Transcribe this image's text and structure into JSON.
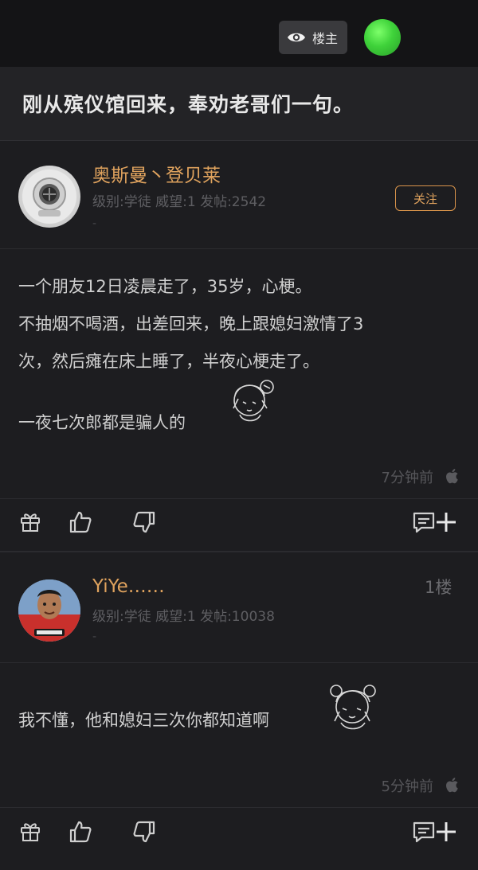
{
  "header": {
    "only_op_label": "楼主",
    "icons": [
      "eye-icon",
      "status-dot-icon"
    ]
  },
  "thread": {
    "title": "刚从殡仪馆回来，奉劝老哥们一句。"
  },
  "posts": [
    {
      "username": "奥斯曼丶登贝莱",
      "meta": "级别:学徒  威望:1  发帖:2542",
      "follow_label": "关注",
      "body": [
        "一个朋友12日凌晨走了，35岁，心梗。",
        "不抽烟不喝酒，出差回来，晚上跟媳妇激情了3",
        "次，然后瘫在床上睡了，半夜心梗走了。",
        "一夜七次郎都是骗人的"
      ],
      "time": "7分钟前",
      "device_icon": "apple-icon"
    },
    {
      "username": "YiYe……",
      "floor": "1楼",
      "meta": "级别:学徒  威望:1  发帖:10038",
      "body": [
        "我不懂，他和媳妇三次你都知道啊"
      ],
      "time": "5分钟前",
      "device_icon": "apple-icon"
    }
  ],
  "colors": {
    "background": "#1d1d20",
    "username": "#e0a35e",
    "meta": "#5e5e62",
    "body": "#cfcfcf"
  }
}
